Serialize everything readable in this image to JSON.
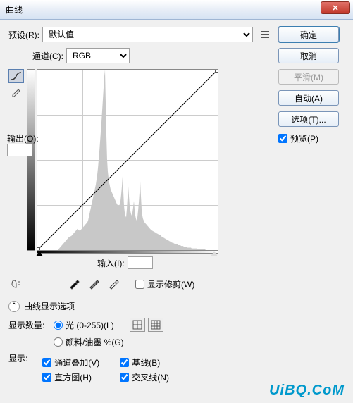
{
  "title": "曲线",
  "close_text": "✕",
  "preset": {
    "label": "预设(R):",
    "value": "默认值"
  },
  "channel": {
    "label": "通道(C):",
    "value": "RGB"
  },
  "output": {
    "label": "输出(O):",
    "value": ""
  },
  "input": {
    "label": "输入(I):",
    "value": ""
  },
  "show_clip": "显示修剪(W)",
  "disp_options_title": "曲线显示选项",
  "amount_label": "显示数量:",
  "amount_opts": [
    "光 (0-255)(L)",
    "颜料/油墨 %(G)"
  ],
  "show_label": "显示:",
  "show_checks": [
    "通道叠加(V)",
    "基线(B)",
    "直方图(H)",
    "交叉线(N)"
  ],
  "buttons": {
    "ok": "确定",
    "cancel": "取消",
    "smooth": "平滑(M)",
    "auto": "自动(A)",
    "options": "选项(T)..."
  },
  "preview": "预览(P)",
  "watermark": "UiBQ.CoM",
  "chart_data": {
    "type": "line",
    "title": "",
    "xlabel": "输入",
    "ylabel": "输出",
    "xlim": [
      0,
      255
    ],
    "ylim": [
      0,
      255
    ],
    "series": [
      {
        "name": "curve",
        "x": [
          0,
          255
        ],
        "y": [
          0,
          255
        ]
      }
    ],
    "histogram": [
      0,
      0,
      0,
      0,
      0,
      0,
      0,
      0,
      0,
      0,
      0,
      0,
      0,
      0,
      0,
      0,
      0,
      0,
      0,
      0,
      0,
      0,
      0,
      0,
      0,
      0,
      0,
      0,
      0,
      0,
      1,
      2,
      3,
      4,
      5,
      6,
      7,
      8,
      9,
      10,
      11,
      12,
      13,
      14,
      15,
      16,
      16,
      17,
      17,
      18,
      19,
      20,
      21,
      22,
      23,
      24,
      25,
      26,
      25,
      24,
      24,
      24,
      25,
      26,
      27,
      28,
      29,
      30,
      31,
      32,
      33,
      34,
      36,
      40,
      44,
      48,
      52,
      56,
      60,
      64,
      68,
      72,
      76,
      80,
      86,
      92,
      100,
      110,
      120,
      132,
      144,
      156,
      170,
      184,
      198,
      212,
      220,
      180,
      140,
      110,
      96,
      88,
      82,
      78,
      74,
      72,
      70,
      68,
      66,
      64,
      62,
      60,
      58,
      56,
      55,
      54,
      54,
      56,
      60,
      68,
      78,
      90,
      72,
      54,
      46,
      42,
      40,
      50,
      64,
      78,
      66,
      54,
      48,
      44,
      42,
      46,
      52,
      60,
      50,
      42,
      38,
      36,
      40,
      48,
      58,
      70,
      84,
      66,
      50,
      42,
      38,
      36,
      34,
      33,
      32,
      31,
      30,
      29,
      28,
      27,
      26,
      25,
      24,
      24,
      23,
      23,
      22,
      22,
      21,
      21,
      20,
      20,
      19,
      19,
      18,
      18,
      17,
      16,
      16,
      15,
      15,
      14,
      14,
      13,
      13,
      12,
      12,
      11,
      11,
      10,
      10,
      9,
      9,
      9,
      8,
      8,
      8,
      7,
      7,
      7,
      6,
      6,
      6,
      6,
      5,
      5,
      5,
      5,
      4,
      4,
      4,
      4,
      4,
      3,
      3,
      3,
      3,
      3,
      3,
      2,
      2,
      2,
      2,
      2,
      2,
      2,
      2,
      1,
      1,
      1,
      1,
      1,
      1,
      1,
      1,
      1,
      1,
      1,
      1,
      0,
      0,
      0,
      0,
      0,
      0,
      0,
      0,
      0,
      0,
      0,
      0,
      0,
      0,
      0,
      0,
      0
    ]
  }
}
